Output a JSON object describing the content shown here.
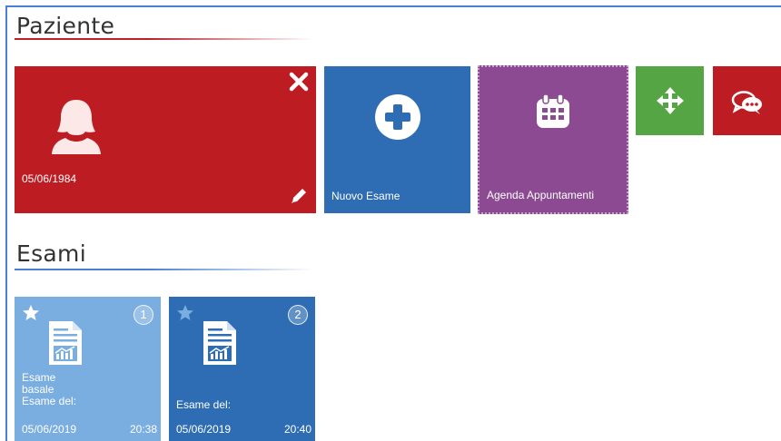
{
  "sections": {
    "patient_title": "Paziente",
    "exams_title": "Esami"
  },
  "patient": {
    "dob": "05/06/1984",
    "color": "#bd1c22"
  },
  "actions": {
    "new_exam_label": "Nuovo Esame",
    "agenda_label": "Agenda Appuntamenti",
    "new_exam_color": "#2e6db3",
    "agenda_color": "#8c4a92",
    "move_color": "#56a544",
    "chat_color": "#bd1c22"
  },
  "exams": [
    {
      "number": "1",
      "name_line1": "Esame",
      "name_line2": "basale",
      "date_prefix": "Esame del:",
      "date": "05/06/2019",
      "time": "20:38",
      "starred": true,
      "color": "#7aade0"
    },
    {
      "number": "2",
      "date_prefix": "Esame del:",
      "date": "05/06/2019",
      "time": "20:40",
      "starred": false,
      "color": "#2e6db3"
    }
  ],
  "icons": {
    "close": "close-icon",
    "avatar": "user-female-icon",
    "edit": "pencil-icon",
    "add": "plus-circle-icon",
    "calendar": "calendar-icon",
    "move": "move-arrows-icon",
    "chat": "chat-bubbles-icon",
    "star": "star-icon",
    "document": "document-chart-icon"
  }
}
